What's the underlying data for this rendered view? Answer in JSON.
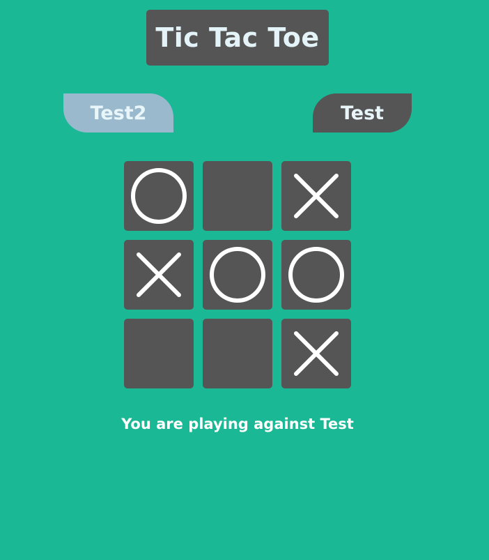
{
  "title": "Tic Tac Toe",
  "players": {
    "left": "Test2",
    "right": "Test"
  },
  "board": [
    [
      "O",
      "",
      "X"
    ],
    [
      "X",
      "O",
      "O"
    ],
    [
      "",
      "",
      "X"
    ]
  ],
  "status": "You are playing against Test",
  "colors": {
    "background": "#1bb896",
    "tile": "#555555",
    "active_player": "#9bb9cd",
    "mark": "#ffffff"
  }
}
